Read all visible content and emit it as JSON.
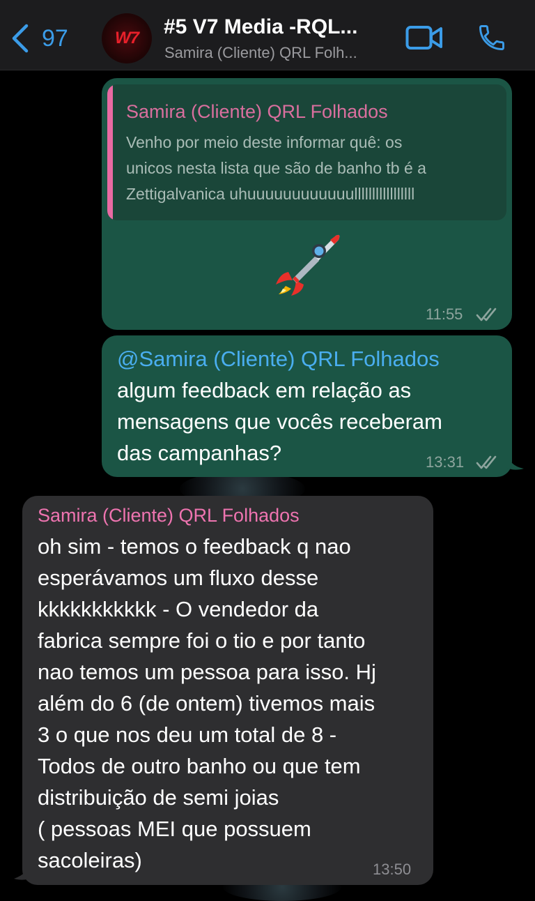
{
  "header": {
    "back_count": "97",
    "title": "#5 V7 Media -RQL...",
    "subtitle": "Samira (Cliente) QRL Folh...",
    "avatar_logo": "W7"
  },
  "messages": [
    {
      "direction": "outgoing",
      "quote": {
        "sender": "Samira (Cliente) QRL Folhados",
        "lines": [
          "Venho por meio deste informar quê: os",
          "unicos nesta lista que são de banho tb é a",
          "Zettigalvanica uhuuuuuuuuuuuulllllllllllllllll"
        ]
      },
      "content": "rocket-emoji",
      "time": "11:55",
      "status": "read"
    },
    {
      "direction": "outgoing",
      "mention": "@Samira (Cliente) QRL Folhados",
      "lines": [
        "algum feedback em relação as",
        "mensagens que vocês receberam",
        "das campanhas?"
      ],
      "time": "13:31",
      "status": "read"
    },
    {
      "direction": "incoming",
      "sender": "Samira (Cliente) QRL Folhados",
      "lines": [
        "oh sim - temos o feedback q nao",
        "esperávamos um fluxo desse",
        "kkkkkkkkkkk  - O vendedor da",
        "fabrica sempre foi o tio e por tanto",
        "nao temos um pessoa para isso. Hj",
        "além do 6 (de ontem) tivemos mais",
        "3 o que nos deu um total de 8 -",
        "Todos de outro banho ou que tem",
        "distribuição de semi joias",
        "( pessoas MEI que possuem",
        "sacoleiras)"
      ],
      "time": "13:50"
    }
  ],
  "colors": {
    "accent": "#3b9ce8",
    "outgoing_bubble": "#1b5545",
    "incoming_bubble": "#2e2e30",
    "sender_name": "#ee74b0"
  }
}
